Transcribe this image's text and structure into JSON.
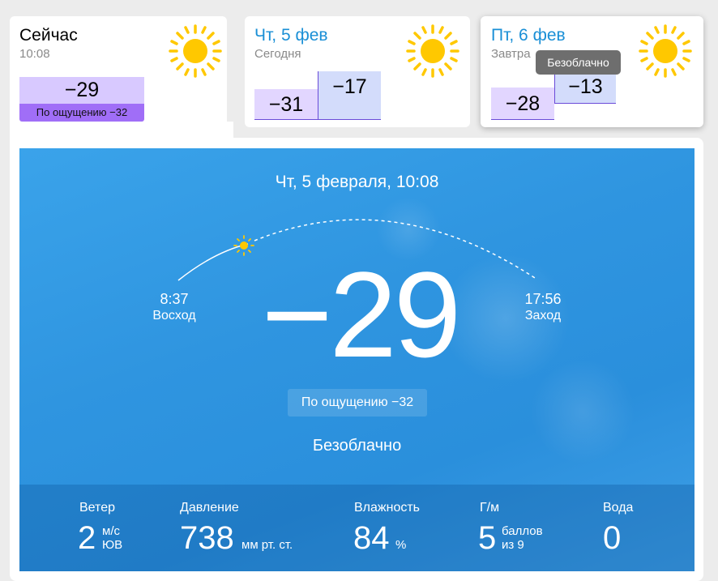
{
  "now": {
    "title": "Сейчас",
    "time": "10:08",
    "temp": "−29",
    "feels": "По ощущению −32"
  },
  "today": {
    "title": "Чт, 5 фев",
    "subtitle": "Сегодня",
    "low": "−31",
    "high": "−17"
  },
  "tomorrow": {
    "title": "Пт, 6 фев",
    "subtitle": "Завтра",
    "low": "−28",
    "high": "−13",
    "tooltip": "Безоблачно"
  },
  "hero": {
    "date": "Чт, 5 февраля, 10:08",
    "temp": "−29",
    "sunrise_time": "8:37",
    "sunrise_label": "Восход",
    "sunset_time": "17:56",
    "sunset_label": "Заход",
    "feels": "По ощущению −32",
    "condition": "Безоблачно"
  },
  "stats": {
    "wind": {
      "label": "Ветер",
      "value": "2",
      "unit_top": "м/с",
      "unit_bottom": "ЮВ"
    },
    "pressure": {
      "label": "Давление",
      "value": "738",
      "unit": "мм рт. ст."
    },
    "humidity": {
      "label": "Влажность",
      "value": "84",
      "unit": "%"
    },
    "geomagnetic": {
      "label": "Г/м",
      "value": "5",
      "unit_top": "баллов",
      "unit_bottom": "из 9"
    },
    "water": {
      "label": "Вода",
      "value": "0"
    }
  },
  "icons": {
    "weather": "sun-icon"
  },
  "colors": {
    "accent": "#1a8fd6",
    "sun": "#ffc800",
    "hero": "#2f95e0",
    "feels": "#a06ef7"
  }
}
